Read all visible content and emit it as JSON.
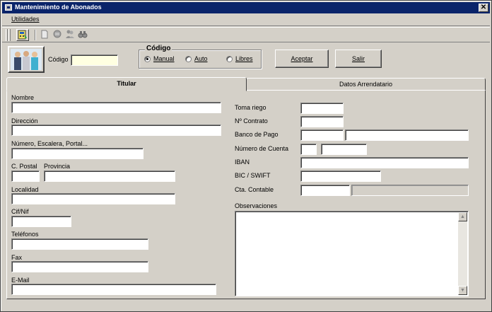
{
  "window": {
    "title": "Mantenimiento de Abonados",
    "close_label": "✕"
  },
  "menu": {
    "items": [
      "Utilidades"
    ]
  },
  "toolbar": {
    "icons": [
      "calculator-icon",
      "document-icon",
      "refresh-icon",
      "users-icon",
      "binoculars-icon"
    ]
  },
  "header": {
    "codigo_label": "Código",
    "codigo_value": "",
    "codigo_group": {
      "title": "Código",
      "options": [
        "Manual",
        "Auto",
        "Libres"
      ],
      "selected": "Manual"
    },
    "accept_label": "Aceptar",
    "exit_label": "Salir"
  },
  "tabs": [
    {
      "label": "Titular",
      "active": true
    },
    {
      "label": "Datos Arrendatario",
      "active": false
    }
  ],
  "titular": {
    "nombre_label": "Nombre",
    "direccion_label": "Dirección",
    "numero_label": "Número, Escalera, Portal...",
    "cpostal_label": "C. Postal",
    "provincia_label": "Provincia",
    "localidad_label": "Localidad",
    "cifnif_label": "Cif/Nif",
    "telefonos_label": "Teléfonos",
    "fax_label": "Fax",
    "email_label": "E-Mail",
    "toma_riego_label": "Toma riego",
    "num_contrato_label": "Nº Contrato",
    "banco_pago_label": "Banco de Pago",
    "num_cuenta_label": "Número de Cuenta",
    "iban_label": "IBAN",
    "bic_label": "BIC / SWIFT",
    "cta_contable_label": "Cta. Contable",
    "observaciones_label": "Observaciones"
  },
  "colors": {
    "title_bar": "#0a246a",
    "face": "#d4d0c8",
    "field_highlight": "#ffffe1"
  }
}
